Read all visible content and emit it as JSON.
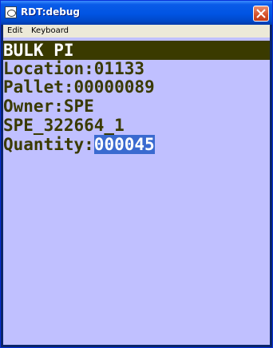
{
  "window": {
    "title": "RDT:debug"
  },
  "menu": {
    "items": [
      "Edit",
      "Keyboard"
    ]
  },
  "screen": {
    "header": "BULK PI",
    "location": "Location:01133",
    "pallet": "Pallet:00000089",
    "owner": "Owner:SPE",
    "reference": "SPE_322664_1",
    "quantity_label": "Quantity:",
    "quantity_value": "000045"
  },
  "colors": {
    "screen_background": "#c0c0ff",
    "text": "#3a3a00",
    "header_bar": "#3a3a00",
    "input_highlight": "#3a6ad0"
  }
}
